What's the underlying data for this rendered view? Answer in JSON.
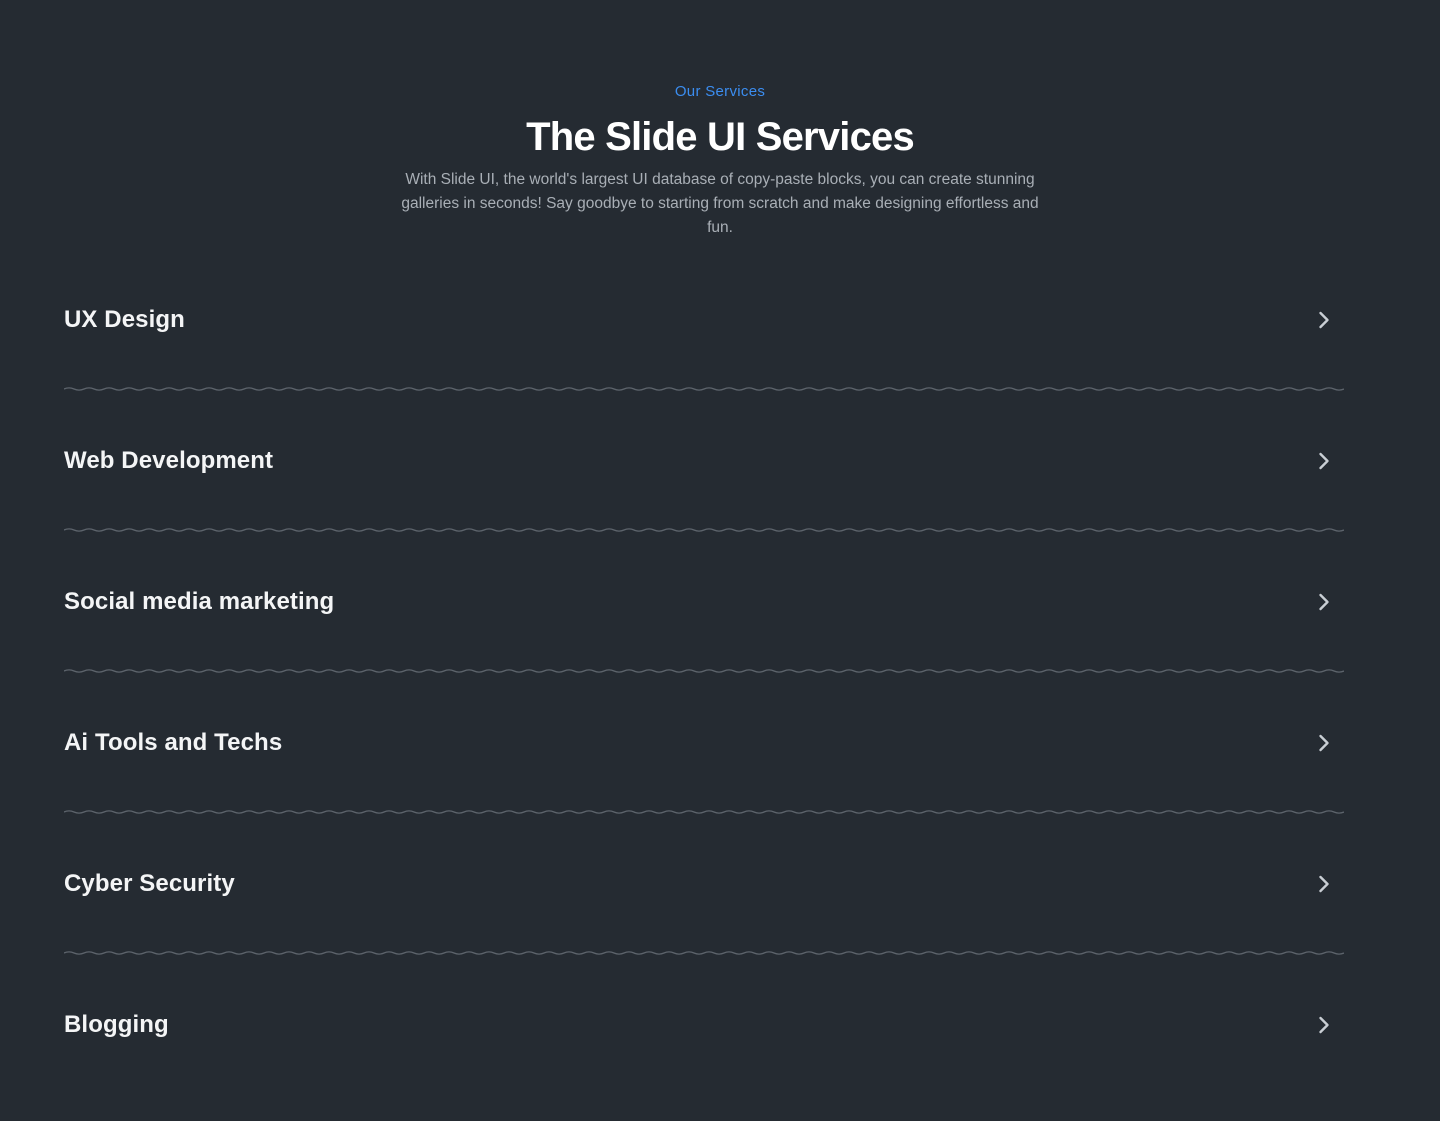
{
  "header": {
    "eyebrow": "Our Services",
    "title": "The Slide UI Services",
    "subtitle": "With Slide UI, the world's largest UI database of copy-paste blocks, you can create stunning galleries in seconds! Say goodbye to starting from scratch and make designing effortless and fun."
  },
  "colors": {
    "background": "#252b32",
    "accent": "#3b8df0",
    "heading": "#ffffff",
    "body_text": "#a9afb6",
    "divider": "#5d646c"
  },
  "services": [
    {
      "label": "UX Design",
      "icon": "chevron-right-icon"
    },
    {
      "label": "Web Development",
      "icon": "chevron-right-icon"
    },
    {
      "label": "Social media marketing",
      "icon": "chevron-right-icon"
    },
    {
      "label": "Ai Tools and Techs",
      "icon": "chevron-right-icon"
    },
    {
      "label": "Cyber Security",
      "icon": "chevron-right-icon"
    },
    {
      "label": "Blogging",
      "icon": "chevron-right-icon"
    }
  ]
}
